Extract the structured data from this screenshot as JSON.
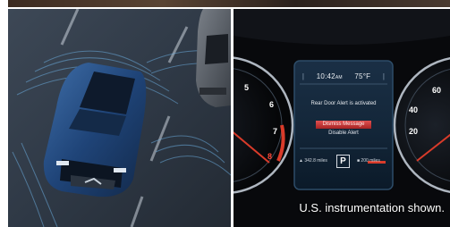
{
  "left_image": {
    "subject": "blue-suv-with-sensor-waves"
  },
  "right_image": {
    "cluster": {
      "time": "10:42",
      "time_suffix": "AM",
      "temperature": "75",
      "temperature_unit": "°F",
      "alert_text": "Rear Door Alert is activated",
      "dismiss_label": "Dismiss Message",
      "disable_label": "Disable Alert",
      "odometer_left": "342.8",
      "odometer_left_unit": "miles",
      "gear": "P",
      "odometer_right": "200",
      "odometer_right_unit": "miles"
    },
    "gauge_numbers_left": [
      "5",
      "6",
      "7",
      "8"
    ],
    "gauge_numbers_right": [
      "60",
      "40",
      "20"
    ],
    "caption": "U.S. instrumentation shown."
  }
}
